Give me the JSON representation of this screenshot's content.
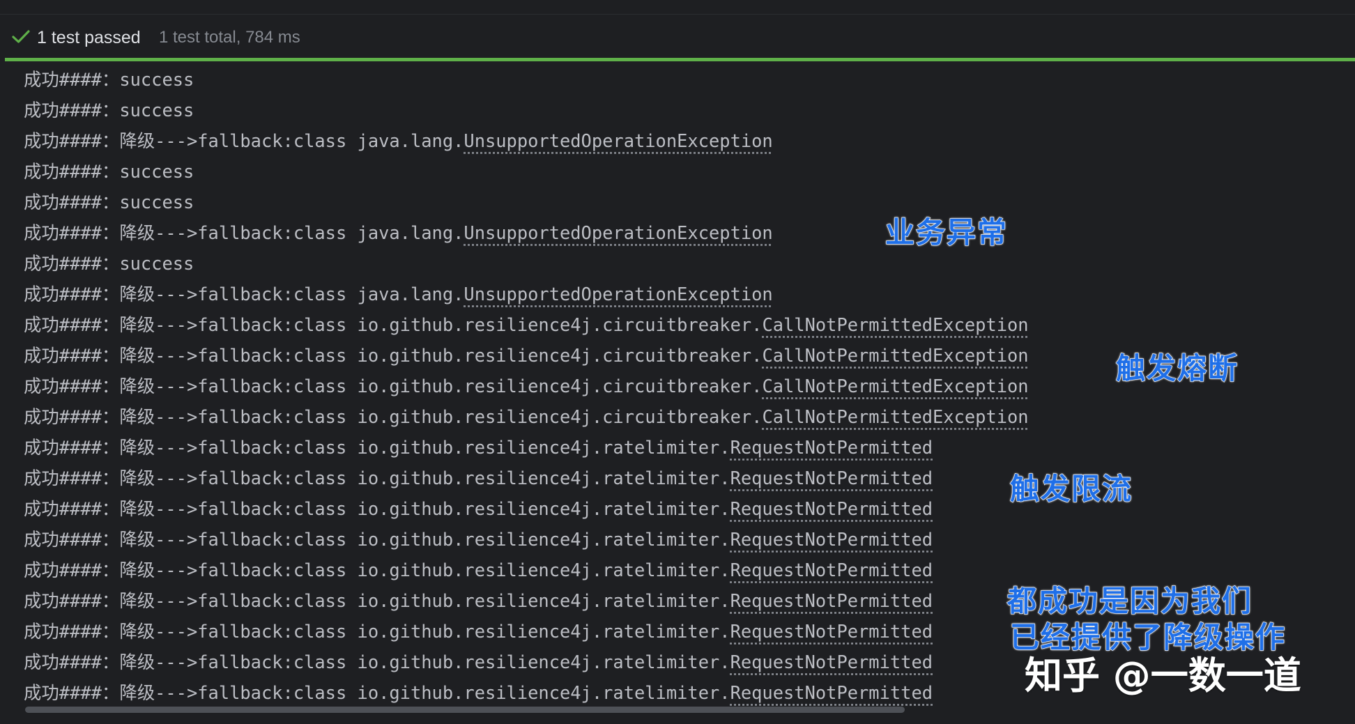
{
  "test_status": {
    "passed_label": "1 test passed",
    "summary": "1 test total, 784 ms",
    "status_color": "#5fb049",
    "icon": "check-icon"
  },
  "log_lines": [
    {
      "prefix": "成功####：success",
      "cls": ""
    },
    {
      "prefix": "成功####：success",
      "cls": ""
    },
    {
      "prefix": "成功####：降级--->fallback:class java.lang.",
      "cls": "UnsupportedOperationException"
    },
    {
      "prefix": "成功####：success",
      "cls": ""
    },
    {
      "prefix": "成功####：success",
      "cls": ""
    },
    {
      "prefix": "成功####：降级--->fallback:class java.lang.",
      "cls": "UnsupportedOperationException"
    },
    {
      "prefix": "成功####：success",
      "cls": ""
    },
    {
      "prefix": "成功####：降级--->fallback:class java.lang.",
      "cls": "UnsupportedOperationException"
    },
    {
      "prefix": "成功####：降级--->fallback:class io.github.resilience4j.circuitbreaker.",
      "cls": "CallNotPermittedException"
    },
    {
      "prefix": "成功####：降级--->fallback:class io.github.resilience4j.circuitbreaker.",
      "cls": "CallNotPermittedException"
    },
    {
      "prefix": "成功####：降级--->fallback:class io.github.resilience4j.circuitbreaker.",
      "cls": "CallNotPermittedException"
    },
    {
      "prefix": "成功####：降级--->fallback:class io.github.resilience4j.circuitbreaker.",
      "cls": "CallNotPermittedException"
    },
    {
      "prefix": "成功####：降级--->fallback:class io.github.resilience4j.ratelimiter.",
      "cls": "RequestNotPermitted"
    },
    {
      "prefix": "成功####：降级--->fallback:class io.github.resilience4j.ratelimiter.",
      "cls": "RequestNotPermitted"
    },
    {
      "prefix": "成功####：降级--->fallback:class io.github.resilience4j.ratelimiter.",
      "cls": "RequestNotPermitted"
    },
    {
      "prefix": "成功####：降级--->fallback:class io.github.resilience4j.ratelimiter.",
      "cls": "RequestNotPermitted"
    },
    {
      "prefix": "成功####：降级--->fallback:class io.github.resilience4j.ratelimiter.",
      "cls": "RequestNotPermitted"
    },
    {
      "prefix": "成功####：降级--->fallback:class io.github.resilience4j.ratelimiter.",
      "cls": "RequestNotPermitted"
    },
    {
      "prefix": "成功####：降级--->fallback:class io.github.resilience4j.ratelimiter.",
      "cls": "RequestNotPermitted"
    },
    {
      "prefix": "成功####：降级--->fallback:class io.github.resilience4j.ratelimiter.",
      "cls": "RequestNotPermitted"
    },
    {
      "prefix": "成功####：降级--->fallback:class io.github.resilience4j.ratelimiter.",
      "cls": "RequestNotPermitted"
    }
  ],
  "annotations": {
    "business_exception": "业务异常",
    "circuit_breaker": "触发熔断",
    "rate_limit": "触发限流",
    "all_success_line1": "都成功是因为我们",
    "all_success_line2": "已经提供了降级操作",
    "color": "#1f6fe8"
  },
  "watermark": "知乎 @一数一道"
}
